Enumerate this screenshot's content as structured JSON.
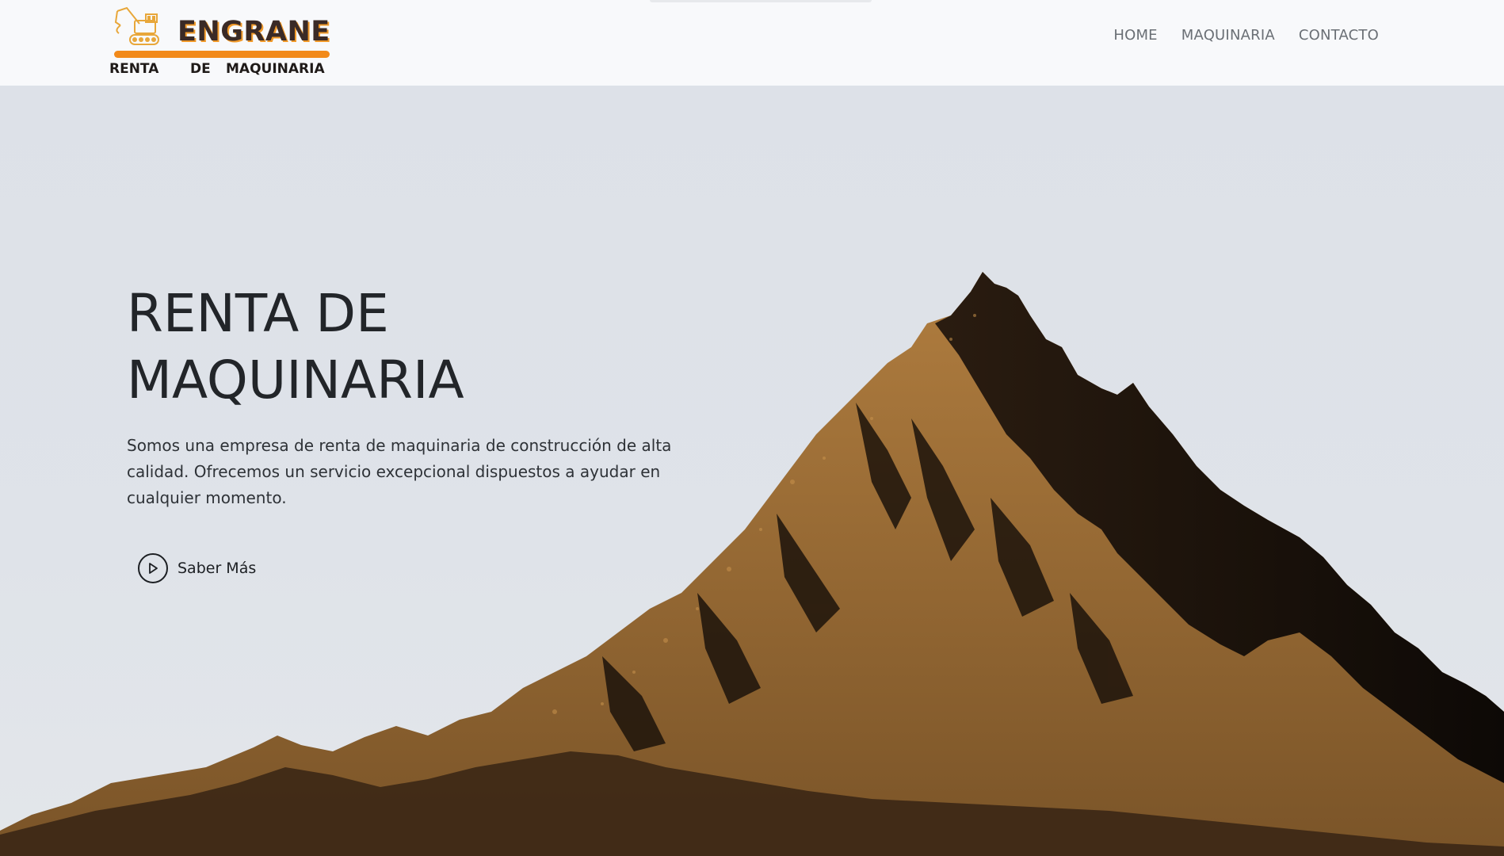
{
  "navbar": {
    "logo": {
      "brand": "ENGRANE",
      "tagline": [
        "RENTA",
        "DE",
        "MAQUINARIA"
      ],
      "icon": "excavator-icon"
    },
    "links": [
      "HOME",
      "MAQUINARIA",
      "CONTACTO"
    ]
  },
  "hero": {
    "title_line1": "RENTA DE",
    "title_line2": "MAQUINARIA",
    "description": "Somos una empresa de renta de maquinaria de construcción de alta calidad. Ofrecemos un servicio excepcional dispuestos a ayudar en cualquier momento.",
    "cta_label": "Saber Más",
    "cta_icon": "play-circle-icon",
    "background_image": "mountain-illustration"
  },
  "colors": {
    "brand_orange": "#f28a1a",
    "brand_dark": "#3a2a26",
    "nav_bg": "#f8f9fb",
    "hero_bg": "#dfe3ea",
    "mountain_light": "#a8763b",
    "mountain_dark": "#1a120b"
  }
}
